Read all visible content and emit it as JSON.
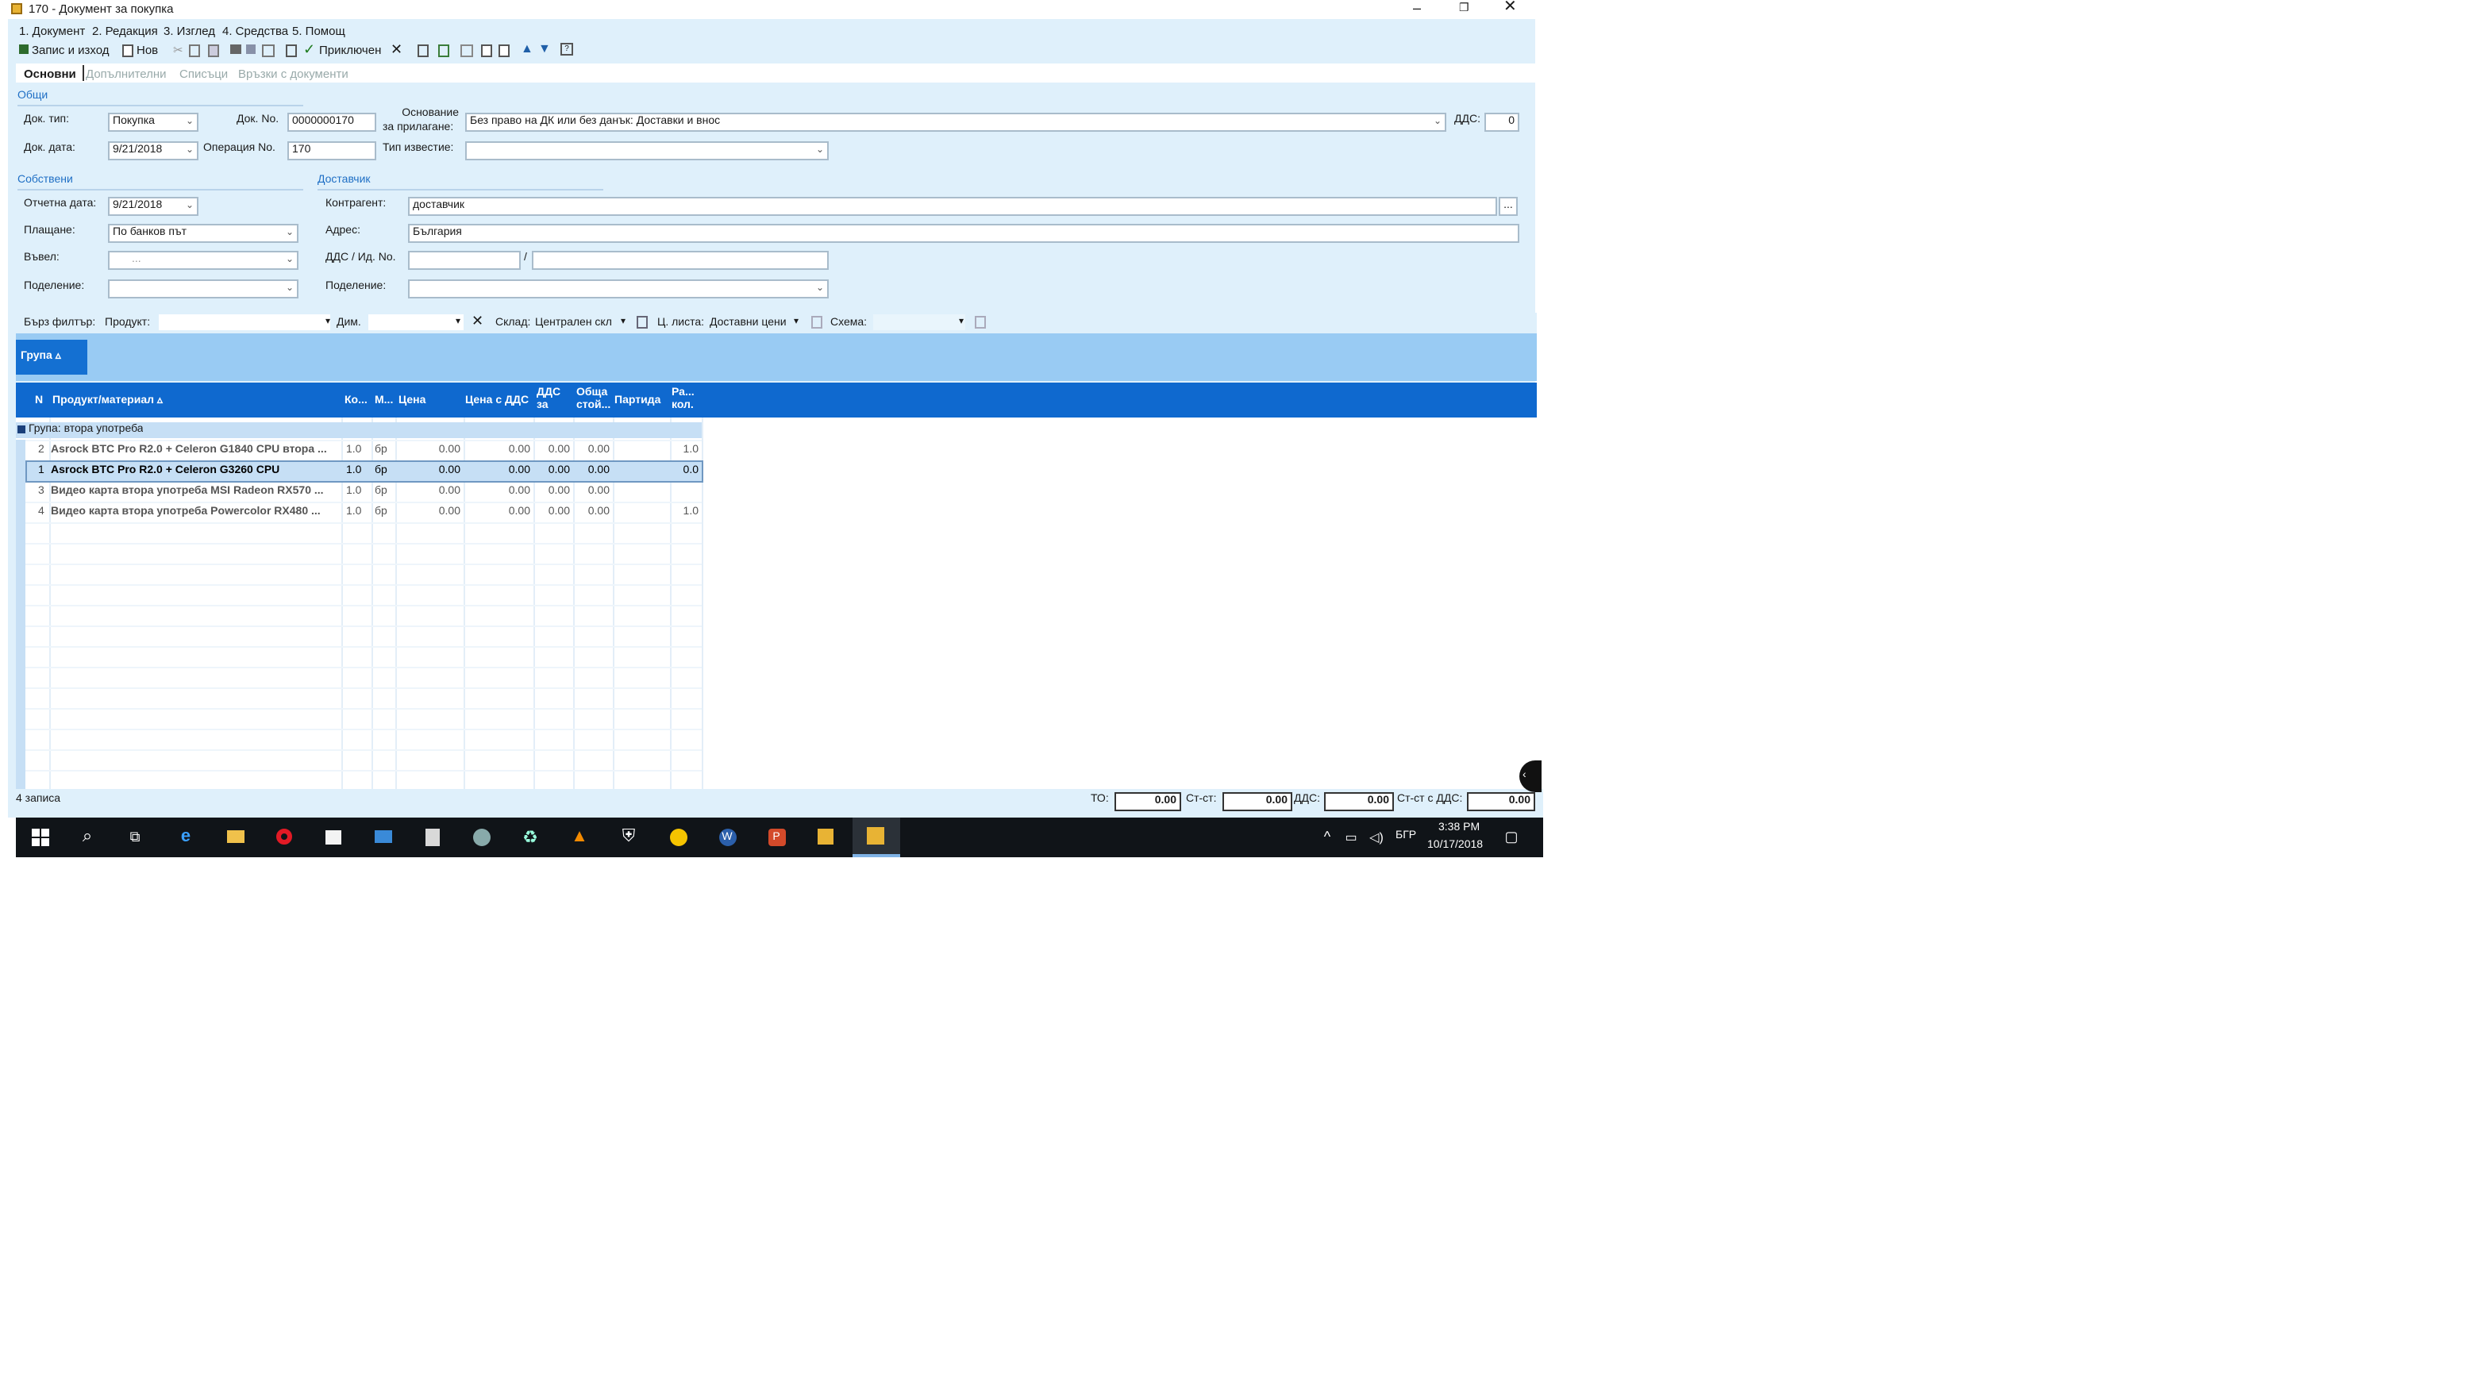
{
  "window": {
    "title": "170 - Документ за покупка"
  },
  "menu": [
    "1. Документ",
    "2. Редакция",
    "3. Изглед",
    "4. Средства",
    "5. Помощ"
  ],
  "toolbar": {
    "save_exit": "Запис и изход",
    "new": "Нов",
    "attached": "Приключен"
  },
  "tabs": [
    "Основни",
    "Допълнителни",
    "Списъци",
    "Връзки с документи"
  ],
  "general": {
    "section": "Общи",
    "doc_type_label": "Док. тип:",
    "doc_type": "Покупка",
    "doc_no_label": "Док. No.",
    "doc_no": "0000000170",
    "basis_label_1": "Основание",
    "basis_label_2": "за прилагане:",
    "basis": "Без право на ДК или без данък: Доставки и внос",
    "vat_label": "ДДС:",
    "vat": "0",
    "doc_date_label": "Док. дата:",
    "doc_date": "9/21/2018",
    "op_no_label": "Операция No.",
    "op_no": "170",
    "notice_type_label": "Тип известие:",
    "notice_type": ""
  },
  "own": {
    "section": "Собствени",
    "report_date_label": "Отчетна дата:",
    "report_date": "9/21/2018",
    "payment_label": "Плащане:",
    "payment": "По банков път",
    "entered_label": "Въвел:",
    "entered": "...",
    "division_label": "Поделение:",
    "division": ""
  },
  "supplier": {
    "section": "Доставчик",
    "contractor_label": "Контрагент:",
    "contractor": "доставчик",
    "address_label": "Адрес:",
    "address": "България",
    "vat_id_label": "ДДС / Ид. No.",
    "vat_no": "",
    "id_no": "",
    "separator": "/",
    "division_label": "Поделение:",
    "division": ""
  },
  "filter": {
    "quick_label": "Бърз филтър:",
    "product_label": "Продукт:",
    "dim_label": "Дим.",
    "warehouse_label": "Склад:",
    "warehouse": "Централен скл",
    "price_list_label": "Ц. листа:",
    "price_list": "Доставни цени",
    "schema_label": "Схема:"
  },
  "group_panel": {
    "tag": "Група ▵"
  },
  "grid": {
    "columns": [
      "N",
      "Продукт/материал ▵",
      "Ко...",
      "М...",
      "Цена",
      "Цена с ДДС",
      "ДДС за",
      "Обща стой...",
      "Партида",
      "Ра... кол."
    ],
    "group_row": "Група: втора употреба",
    "rows": [
      {
        "n": "2",
        "product": "Asrock BTC Pro R2.0 + Celeron G1840 CPU втора ...",
        "qty": "1.0",
        "unit": "бр",
        "price": "0.00",
        "price_vat": "0.00",
        "vat": "0.00",
        "total": "0.00",
        "batch": "",
        "extra": "1.0",
        "selected": false
      },
      {
        "n": "1",
        "product": "Asrock BTC Pro R2.0 + Celeron G3260 CPU",
        "qty": "1.0",
        "unit": "бр",
        "price": "0.00",
        "price_vat": "0.00",
        "vat": "0.00",
        "total": "0.00",
        "batch": "",
        "extra": "0.0",
        "selected": true
      },
      {
        "n": "3",
        "product": "Видео карта втора употреба MSI Radeon RX570 ...",
        "qty": "1.0",
        "unit": "бр",
        "price": "0.00",
        "price_vat": "0.00",
        "vat": "0.00",
        "total": "0.00",
        "batch": "",
        "extra": "",
        "selected": false
      },
      {
        "n": "4",
        "product": "Видео карта втора употреба Powercolor RX480 ...",
        "qty": "1.0",
        "unit": "бр",
        "price": "0.00",
        "price_vat": "0.00",
        "vat": "0.00",
        "total": "0.00",
        "batch": "",
        "extra": "1.0",
        "selected": false
      }
    ]
  },
  "status": {
    "records": "4 записа",
    "to_label": "ТО:",
    "to": "0.00",
    "value_label": "Ст-ст:",
    "value": "0.00",
    "vat_label": "ДДС:",
    "vat": "0.00",
    "value_vat_label": "Ст-ст с ДДС:",
    "value_vat": "0.00"
  },
  "taskbar": {
    "lang": "БГР",
    "time": "3:38 PM",
    "date": "10/17/2018"
  },
  "colors": {
    "accent": "#0f69cf",
    "panel": "#dff0fb",
    "group_zone": "#99cbf3",
    "selected_row": "#c6dff5"
  }
}
